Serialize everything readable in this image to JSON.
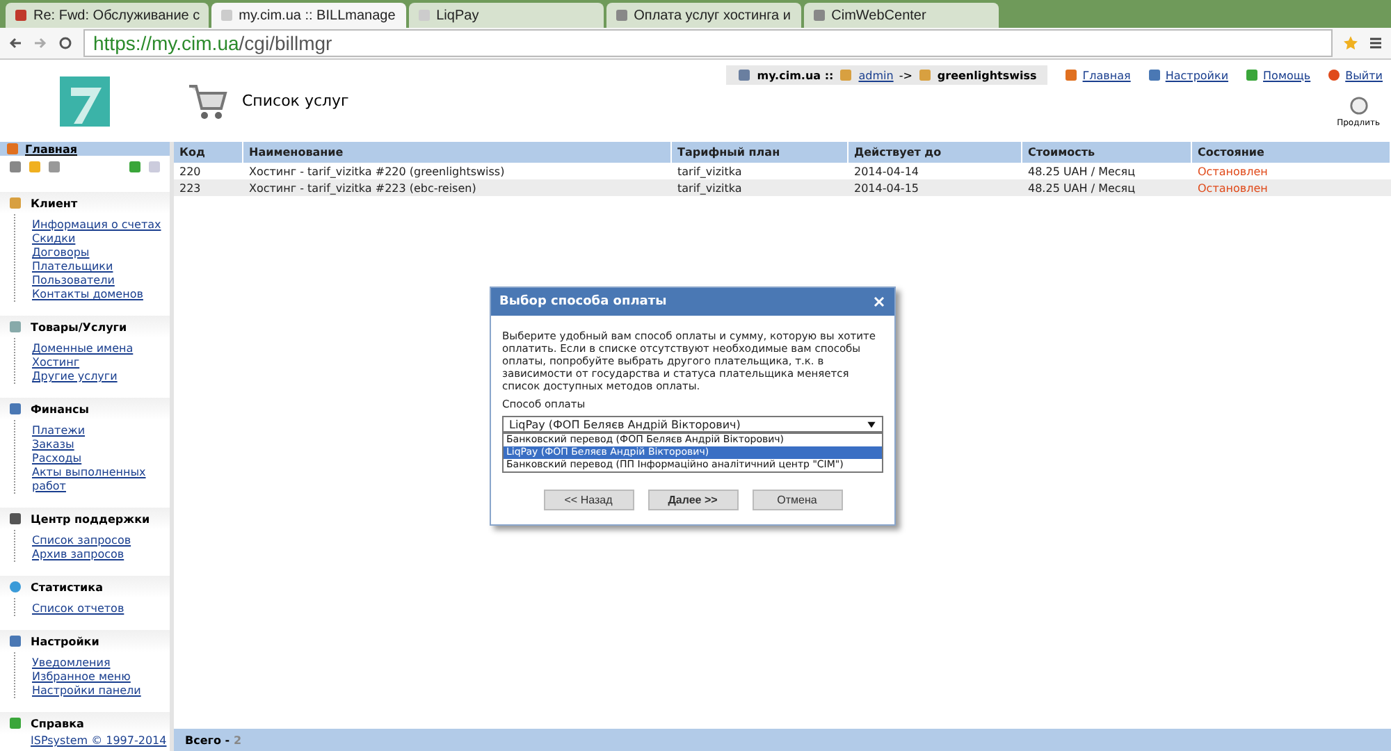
{
  "browser": {
    "tabs": [
      {
        "label": "Re: Fwd: Обслуживание с",
        "selected": false
      },
      {
        "label": "my.cim.ua :: BILLmanage",
        "selected": true
      },
      {
        "label": "LiqPay",
        "selected": false
      },
      {
        "label": "Оплата услуг хостинга и",
        "selected": false
      },
      {
        "label": "CimWebCenter",
        "selected": false
      }
    ],
    "url_host": "https://my.cim.ua",
    "url_path": "/cgi/billmgr"
  },
  "userbar": {
    "site": "my.cim.ua ::",
    "user": "admin",
    "arrow": "->",
    "client": "greenlightswiss",
    "links": [
      "Главная",
      "Настройки",
      "Помощь",
      "Выйти"
    ]
  },
  "page_title": "Список услуг",
  "action": {
    "label": "Продлить"
  },
  "sidebar": {
    "home": "Главная",
    "sections": [
      {
        "title": "Клиент",
        "items": [
          "Информация о счетах",
          "Скидки",
          "Договоры",
          "Плательщики",
          "Пользователи",
          "Контакты доменов"
        ]
      },
      {
        "title": "Товары/Услуги",
        "items": [
          "Доменные имена",
          "Хостинг",
          "Другие услуги"
        ]
      },
      {
        "title": "Финансы",
        "items": [
          "Платежи",
          "Заказы",
          "Расходы",
          "Акты выполненных работ"
        ]
      },
      {
        "title": "Центр поддержки",
        "items": [
          "Список запросов",
          "Архив запросов"
        ]
      },
      {
        "title": "Статистика",
        "items": [
          "Список отчетов"
        ]
      },
      {
        "title": "Настройки",
        "items": [
          "Уведомления",
          "Избранное меню",
          "Настройки панели"
        ]
      },
      {
        "title": "Справка"
      }
    ],
    "copyright": "ISPsystem © 1997-2014"
  },
  "table": {
    "columns": [
      "Код",
      "Наименование",
      "Тарифный план",
      "Действует до",
      "Стоимость",
      "Состояние"
    ],
    "rows": [
      [
        "220",
        "Хостинг - tarif_vizitka #220 (greenlightswiss)",
        "tarif_vizitka",
        "2014-04-14",
        "48.25 UAH / Месяц",
        "Остановлен"
      ],
      [
        "223",
        "Хостинг - tarif_vizitka #223 (ebc-reisen)",
        "tarif_vizitka",
        "2014-04-15",
        "48.25 UAH / Месяц",
        "Остановлен"
      ]
    ]
  },
  "footer": {
    "label": "Всего -",
    "count": "2"
  },
  "dialog": {
    "title": "Выбор способа оплаты",
    "text": "Выберите удобный вам способ оплаты и сумму, которую вы хотите оплатить. Если в списке отсутствуют необходимые вам способы оплаты, попробуйте выбрать другого плательщика, т.к. в зависимости от государства и статуса плательщика меняется список доступных методов оплаты.",
    "field_label": "Способ оплаты",
    "value": "LiqPay (ФОП Беляєв Андрій Вікторович)",
    "options": [
      {
        "label": "Банковский перевод (ФОП Беляєв Андрій Вікторович)",
        "selected": false
      },
      {
        "label": "LiqPay (ФОП Беляєв Андрій Вікторович)",
        "selected": true
      },
      {
        "label": "Банковский перевод (ПП Інформаційно аналітичний центр \"CIM\")",
        "selected": false
      }
    ],
    "buttons": [
      "<< Назад",
      "Далее >>",
      "Отмена"
    ]
  }
}
